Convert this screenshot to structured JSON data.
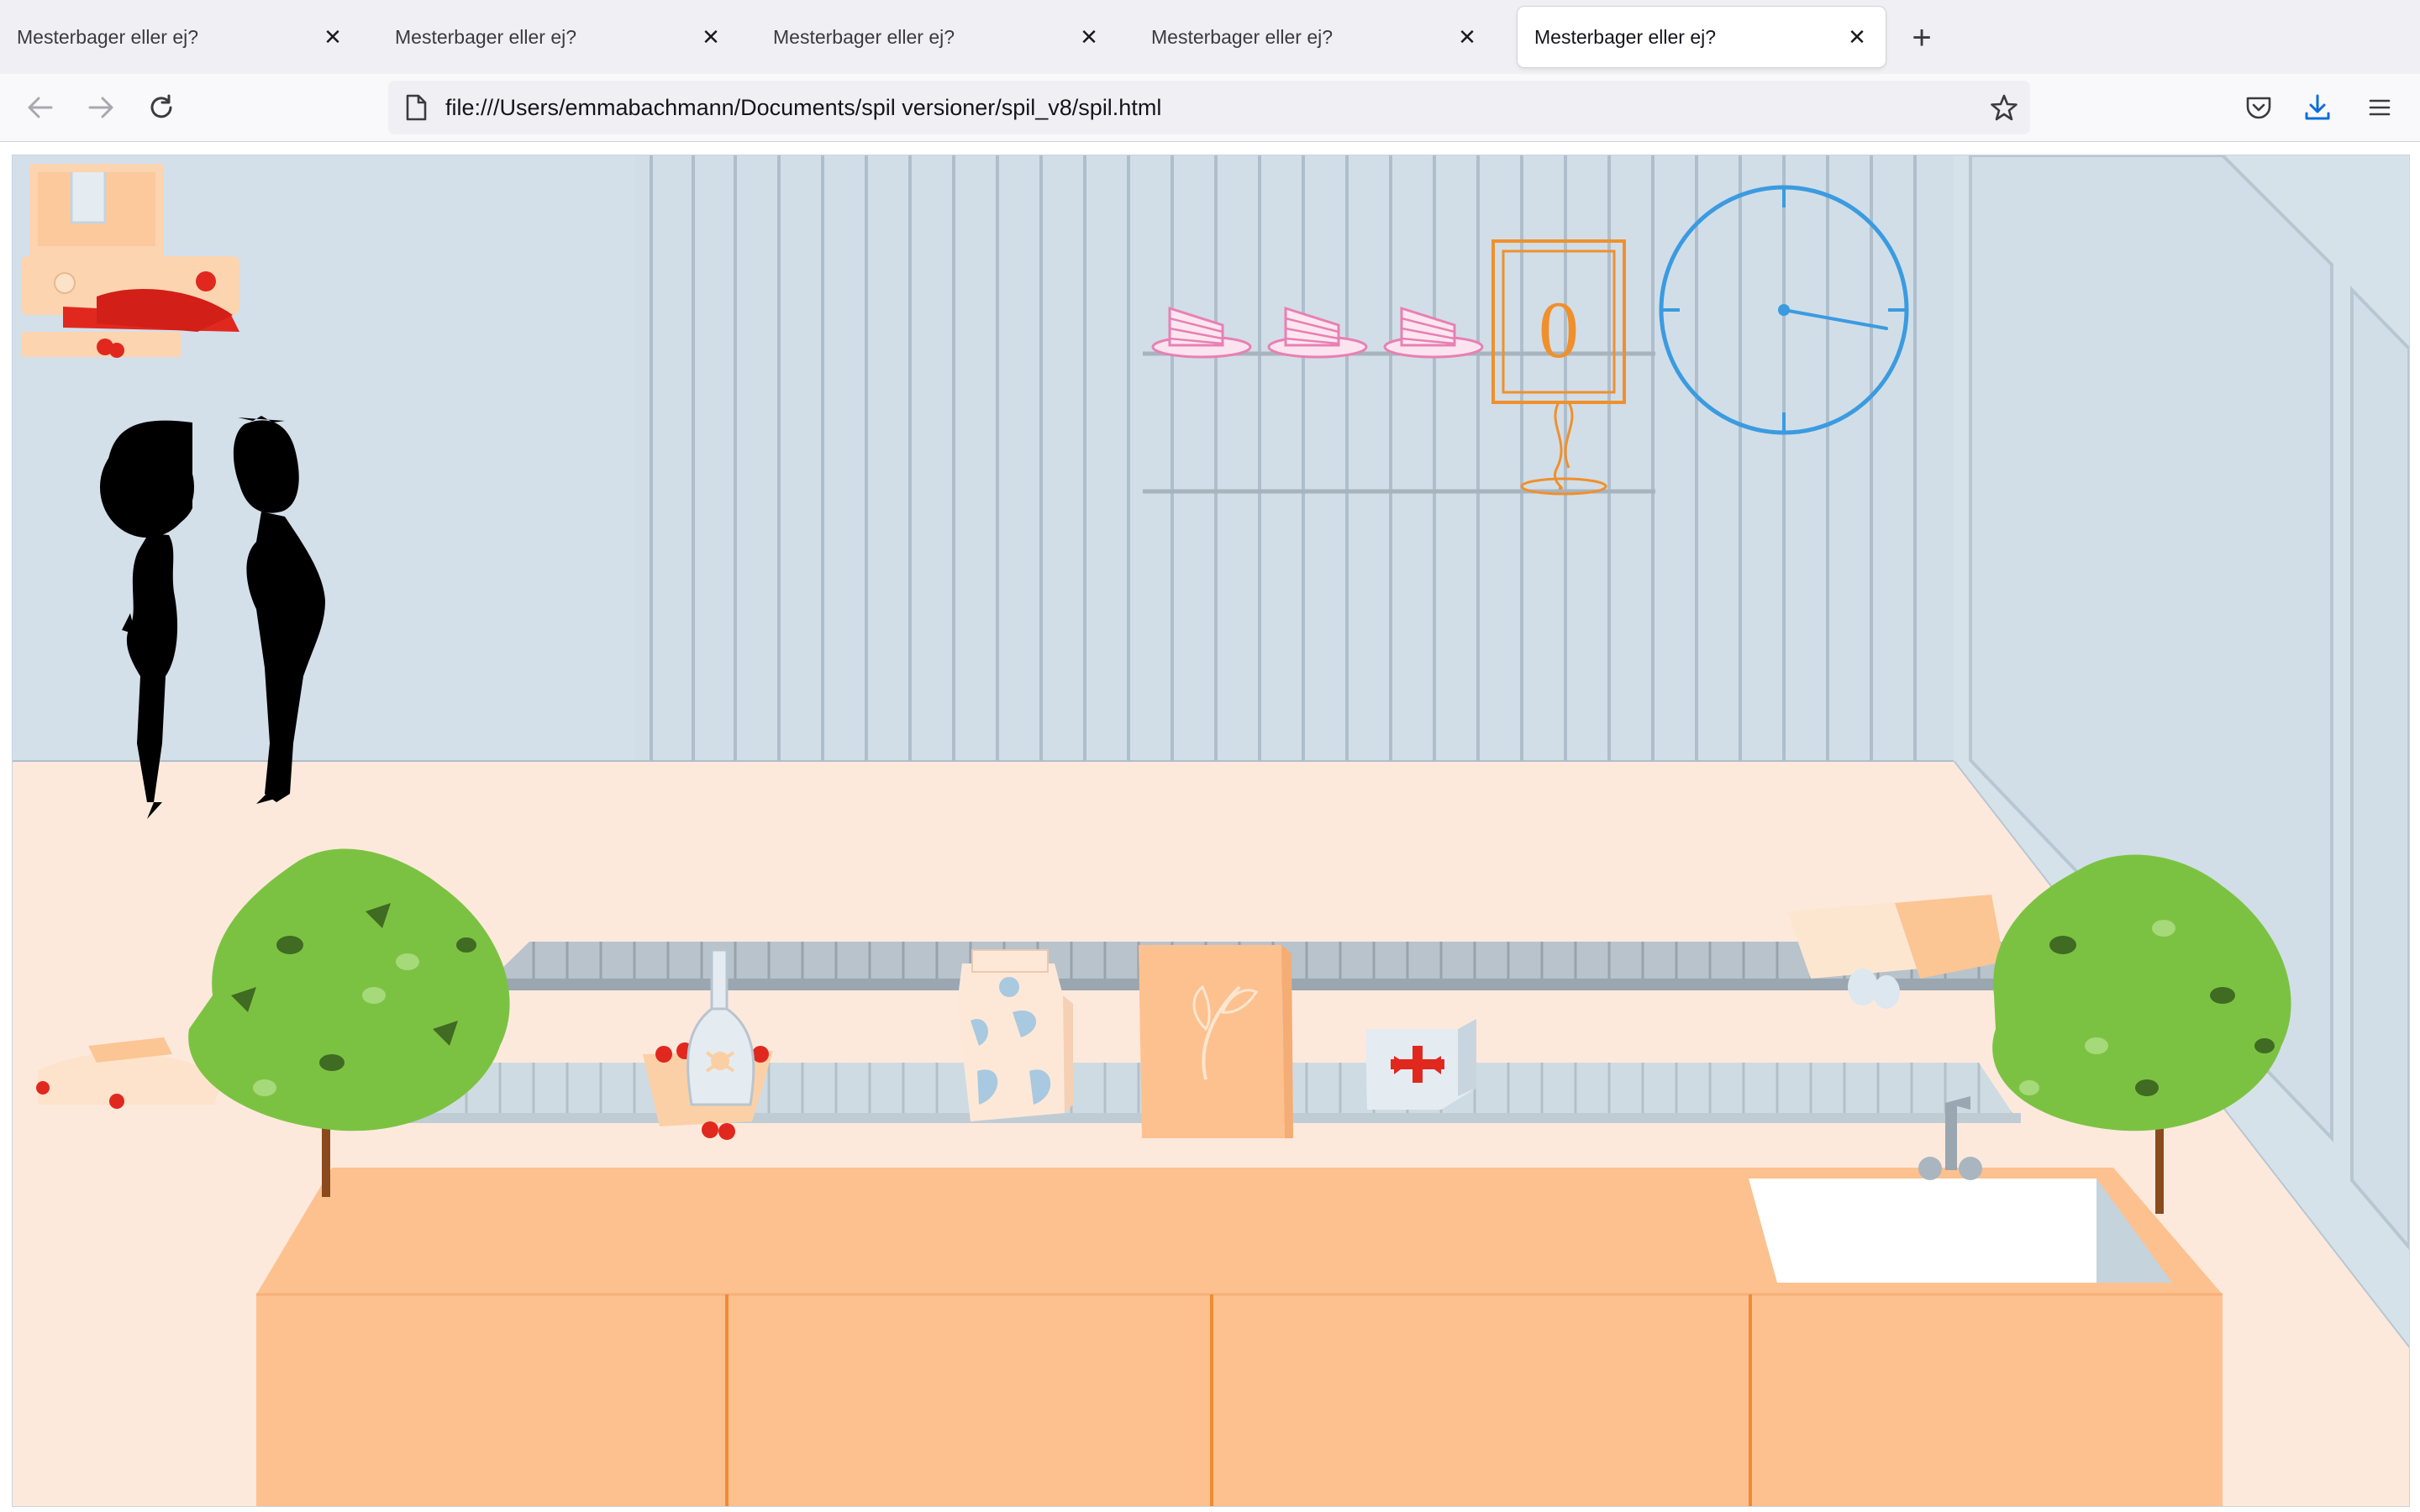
{
  "browser": {
    "tabs": [
      {
        "title": "Mesterbager eller ej?",
        "active": false
      },
      {
        "title": "Mesterbager eller ej?",
        "active": false
      },
      {
        "title": "Mesterbager eller ej?",
        "active": false
      },
      {
        "title": "Mesterbager eller ej?",
        "active": false
      },
      {
        "title": "Mesterbager eller ej?",
        "active": true
      }
    ],
    "tab_close_glyph": "✕",
    "new_tab_glyph": "+",
    "url": "file:///Users/emmabachmann/Documents/spil versioner/spil_v8/spil.html",
    "icons": [
      "back-arrow-icon",
      "forward-arrow-icon",
      "reload-icon",
      "page-icon",
      "bookmark-star-icon",
      "pocket-icon",
      "download-icon",
      "menu-icon"
    ]
  },
  "game": {
    "score": "0",
    "cakes_shown": 3,
    "colors": {
      "wall": "#d3e0ea",
      "floor": "#fde9dc",
      "counter": "#fdc18f",
      "score_orange": "#f0902c",
      "clock_blue": "#3b9be0",
      "cake_pink": "#e880b4",
      "bush_green": "#7cc242"
    },
    "items": [
      "strawberries",
      "poison-bottle",
      "milk-carton",
      "flour-bag",
      "first-aid-box",
      "egg-carton"
    ]
  }
}
